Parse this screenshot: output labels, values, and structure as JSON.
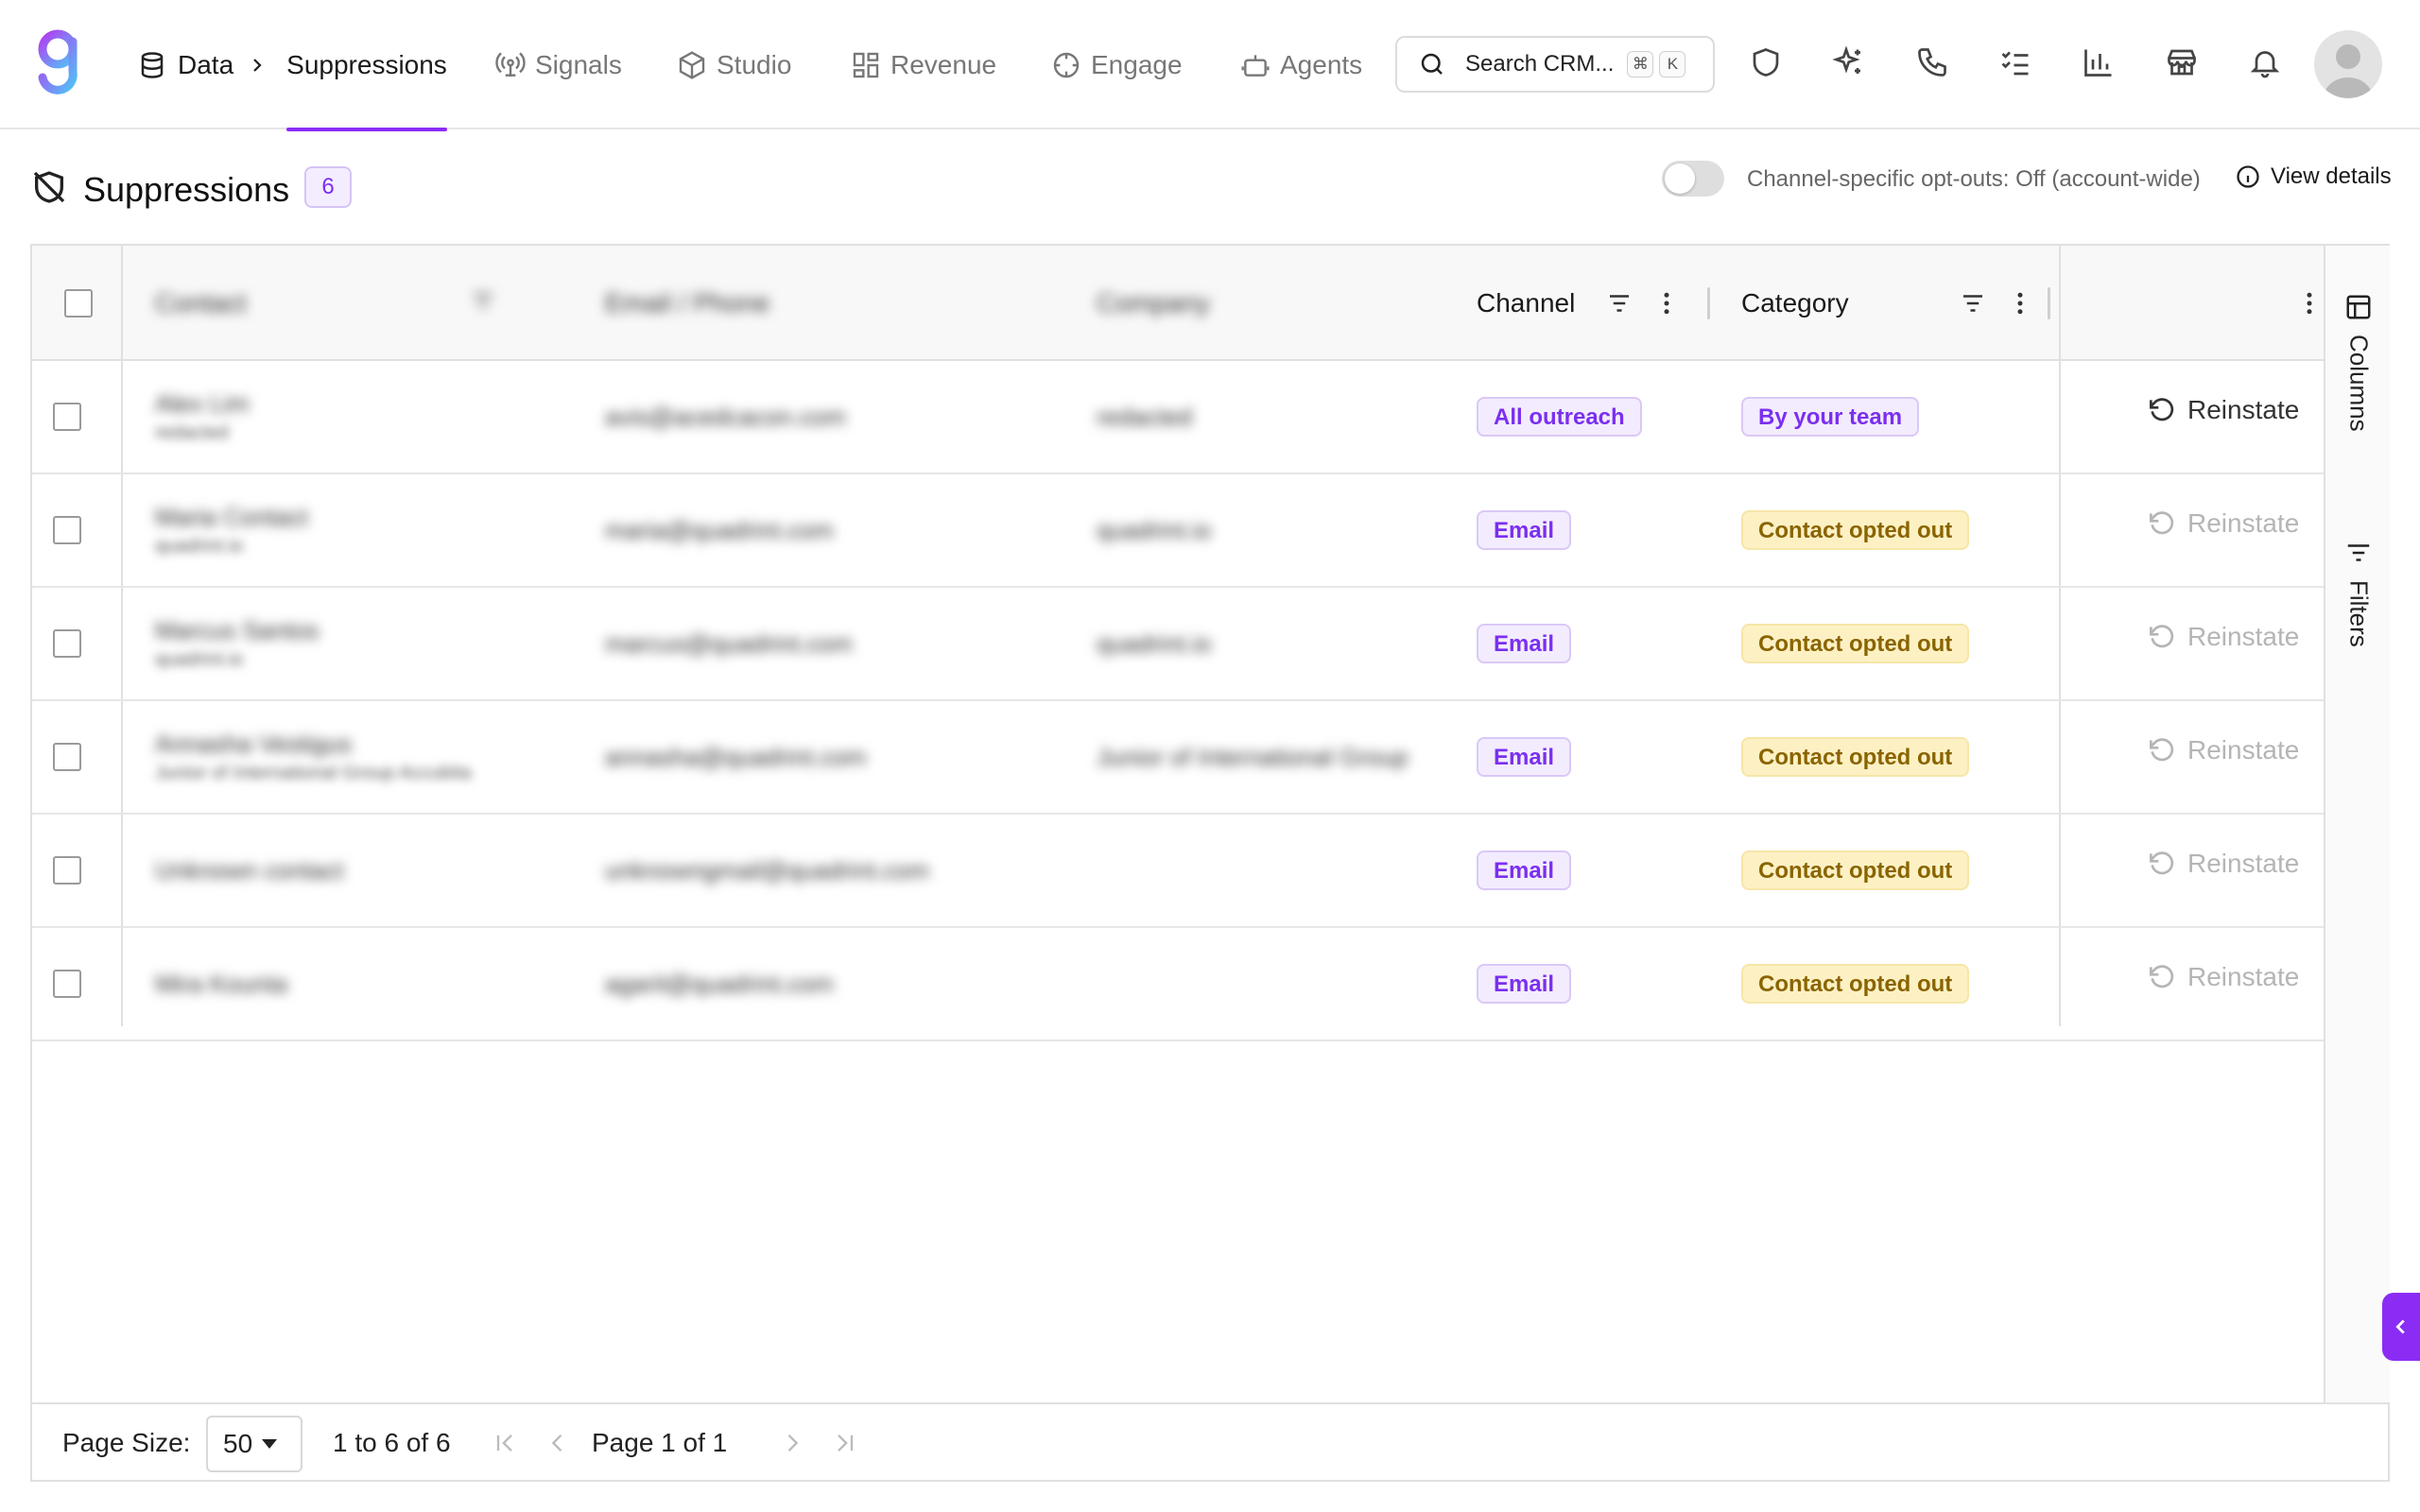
{
  "nav": {
    "breadcrumb_root": "Data",
    "breadcrumb_current": "Suppressions",
    "links": [
      "Signals",
      "Studio",
      "Revenue",
      "Engage",
      "Agents"
    ],
    "search_placeholder": "Search CRM...",
    "search_kbd_mod": "⌘",
    "search_kbd_key": "K"
  },
  "header": {
    "title": "Suppressions",
    "count": "6",
    "toggle_label": "Channel-specific opt-outs: Off (account-wide)",
    "toggle_on": false,
    "view_details": "View details"
  },
  "table": {
    "columns": {
      "contact": "Contact",
      "email_phone": "Email / Phone",
      "company": "Company",
      "channel": "Channel",
      "category": "Category"
    },
    "rows": [
      {
        "contact": "Alex Lim",
        "contact_sub": "redacted",
        "email": "avis@acedcacon.com",
        "company": "redacted",
        "channel": "All outreach",
        "category": "By your team",
        "reinstate": "Reinstate",
        "reinstate_enabled": true
      },
      {
        "contact": "Maria Contact",
        "contact_sub": "quadrint.io",
        "email": "maria@quadrint.com",
        "company": "quadrint.io",
        "channel": "Email",
        "category": "Contact opted out",
        "reinstate": "Reinstate",
        "reinstate_enabled": false
      },
      {
        "contact": "Marcus Santos",
        "contact_sub": "quadrint.io",
        "email": "marcus@quadrint.com",
        "company": "quadrint.io",
        "channel": "Email",
        "category": "Contact opted out",
        "reinstate": "Reinstate",
        "reinstate_enabled": false
      },
      {
        "contact": "Annasha Vestigus",
        "contact_sub": "Junior of International Group Accubita",
        "email": "annasha@quadrint.com",
        "company": "Junior of International Group",
        "channel": "Email",
        "category": "Contact opted out",
        "reinstate": "Reinstate",
        "reinstate_enabled": false
      },
      {
        "contact": "Unknown contact",
        "contact_sub": "",
        "email": "unknowngmail@quadrint.com",
        "company": "",
        "channel": "Email",
        "category": "Contact opted out",
        "reinstate": "Reinstate",
        "reinstate_enabled": false
      },
      {
        "contact": "Mira Kounta",
        "contact_sub": "",
        "email": "agarit@quadrint.com",
        "company": "",
        "channel": "Email",
        "category": "Contact opted out",
        "reinstate": "Reinstate",
        "reinstate_enabled": false
      }
    ]
  },
  "side_panel": {
    "columns": "Columns",
    "filters": "Filters"
  },
  "pagination": {
    "page_size_label": "Page Size:",
    "page_size": "50",
    "range_text": "1 to 6 of 6",
    "page_text": "Page 1 of 1"
  },
  "colors": {
    "accent": "#8b2cf5",
    "chip_purple_bg": "#f3ecff",
    "chip_yellow_bg": "#fdf1c4"
  }
}
